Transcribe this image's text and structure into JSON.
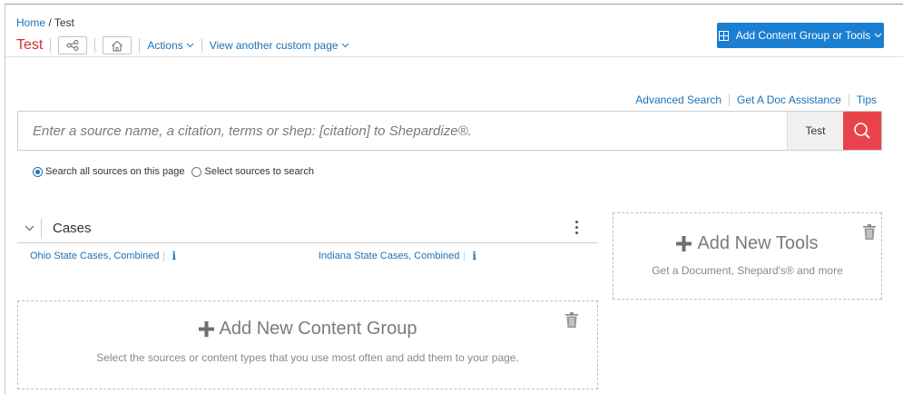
{
  "breadcrumb": {
    "home": "Home",
    "separator": "/",
    "current": "Test"
  },
  "page": {
    "title": "Test"
  },
  "toolbar": {
    "share_icon": "share-icon",
    "home_icon": "home-icon",
    "actions_label": "Actions",
    "custom_page_label": "View another custom page"
  },
  "add_content_button": {
    "label": "Add Content Group or Tools",
    "icon": "grid-icon"
  },
  "top_links": [
    "Advanced Search",
    "Get A Doc Assistance",
    "Tips"
  ],
  "search": {
    "placeholder": "Enter a source name, a citation, terms or shep: [citation] to Shepardize®.",
    "value": "",
    "scope": "Test",
    "button_icon": "search-icon"
  },
  "search_options": {
    "all_label": "Search all sources on this page",
    "select_label": "Select sources to search",
    "selected": "all"
  },
  "cases": {
    "title": "Cases",
    "sources": [
      {
        "name": "Ohio State Cases, Combined",
        "info": "i"
      },
      {
        "name": "Indiana State Cases, Combined",
        "info": "i"
      }
    ]
  },
  "add_tools": {
    "title": "Add New Tools",
    "description": "Get a Document, Shepard's® and more"
  },
  "add_group": {
    "title": "Add New Content Group",
    "description": "Select the sources or content types that you use most often and add them to your page."
  },
  "colors": {
    "accent_blue": "#1a7ed1",
    "link_blue": "#1a73b8",
    "title_red": "#d32f2f",
    "search_red": "#e8434b"
  }
}
